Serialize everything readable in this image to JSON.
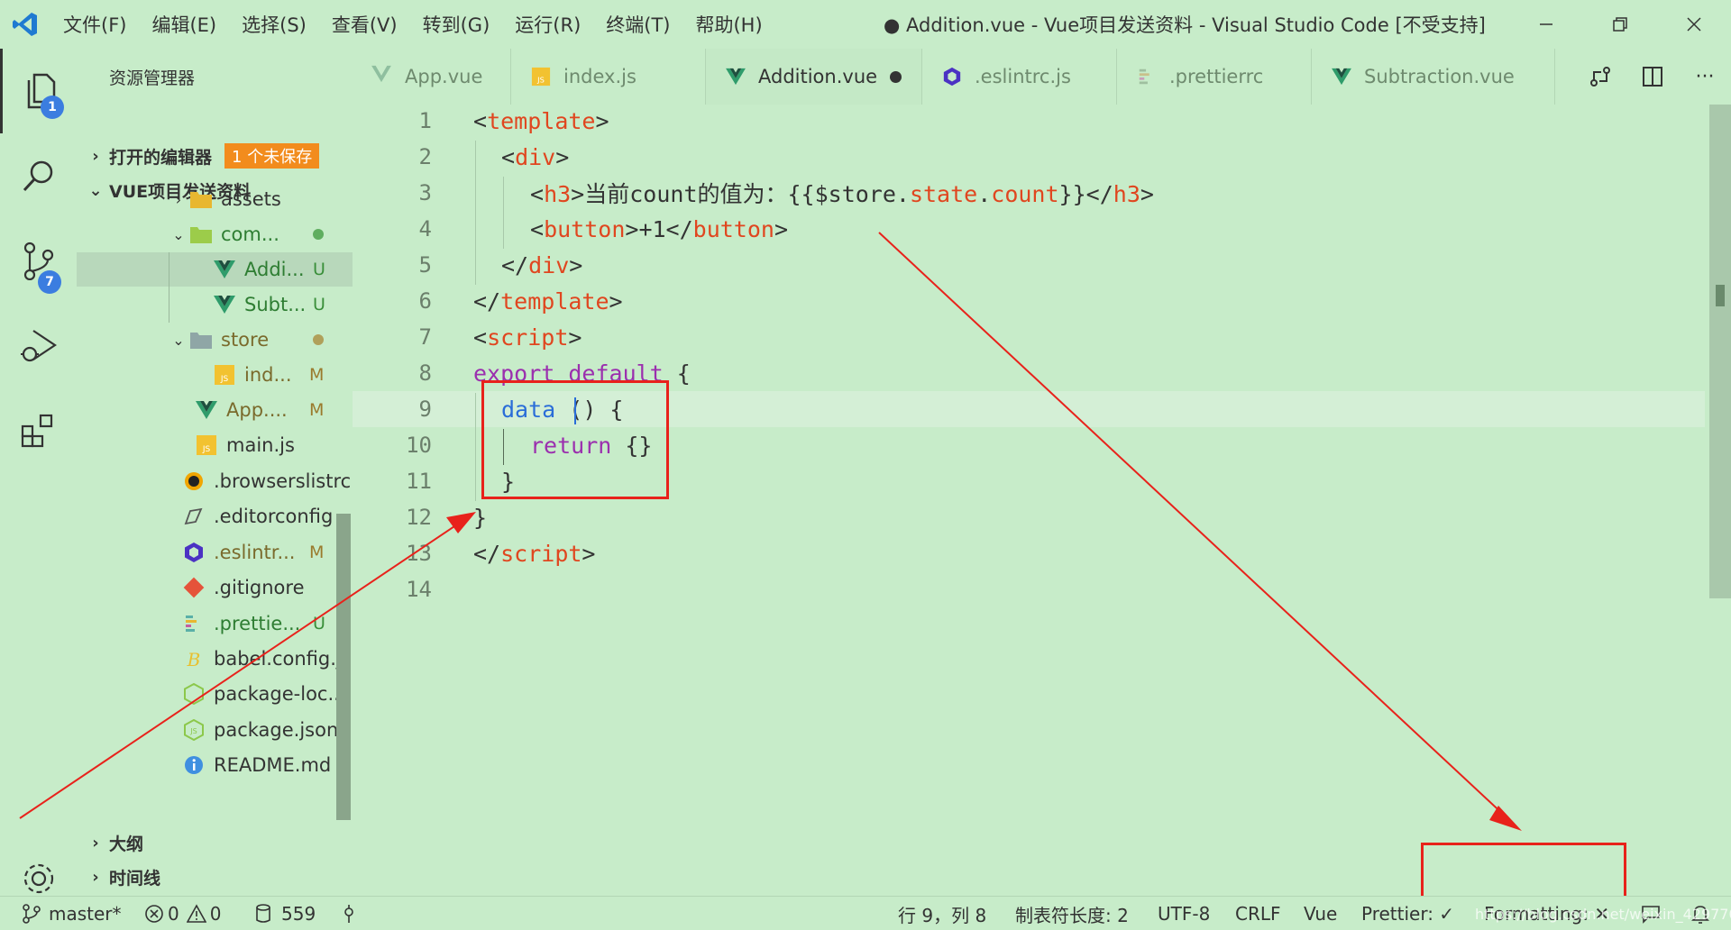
{
  "titlebar": {
    "menu": [
      "文件(F)",
      "编辑(E)",
      "选择(S)",
      "查看(V)",
      "转到(G)",
      "运行(R)",
      "终端(T)",
      "帮助(H)"
    ],
    "title": "● Addition.vue - Vue项目发送资料 - Visual Studio Code [不受支持]"
  },
  "activity": {
    "explorer_badge": "1",
    "scm_badge": "7"
  },
  "sidebar": {
    "header": "资源管理器",
    "open_editors": "打开的编辑器",
    "unsaved_badge": "1 个未保存",
    "project": "VUE项目发送资料",
    "tree": [
      {
        "name": "assets",
        "status": ""
      },
      {
        "name": "com...",
        "status": "dot"
      },
      {
        "name": "Addi...",
        "status": "U"
      },
      {
        "name": "Subt...",
        "status": "U"
      },
      {
        "name": "store",
        "status": "dot"
      },
      {
        "name": "ind...",
        "status": "M"
      },
      {
        "name": "App....",
        "status": "M"
      },
      {
        "name": "main.js",
        "status": ""
      },
      {
        "name": ".browserslistrc",
        "status": ""
      },
      {
        "name": ".editorconfig",
        "status": ""
      },
      {
        "name": ".eslintr...",
        "status": "M"
      },
      {
        "name": ".gitignore",
        "status": ""
      },
      {
        "name": ".prettie...",
        "status": "U"
      },
      {
        "name": "babel.config.js",
        "status": ""
      },
      {
        "name": "package-loc...",
        "status": ""
      },
      {
        "name": "package.json",
        "status": ""
      },
      {
        "name": "README.md",
        "status": ""
      }
    ],
    "outline": "大纲",
    "timeline": "时间线"
  },
  "tabs": [
    {
      "label": "App.vue"
    },
    {
      "label": "index.js"
    },
    {
      "label": "Addition.vue"
    },
    {
      "label": ".eslintrc.js"
    },
    {
      "label": ".prettierrc"
    },
    {
      "label": "Subtraction.vue"
    }
  ],
  "editor": {
    "line_numbers": [
      "1",
      "2",
      "3",
      "4",
      "5",
      "6",
      "7",
      "8",
      "9",
      "10",
      "11",
      "12",
      "13",
      "14"
    ],
    "lines": {
      "l1": [
        "<",
        "template",
        ">"
      ],
      "l2": [
        "<",
        "div",
        ">"
      ],
      "l3": [
        "<",
        "h3",
        ">",
        "当前count的值为：{{$store.",
        "state",
        ".",
        "count",
        "}}</",
        "h3",
        ">"
      ],
      "l4": [
        "<",
        "button",
        ">",
        "+1</",
        "button",
        ">"
      ],
      "l5": [
        "</",
        "div",
        ">"
      ],
      "l6": [
        "</",
        "template",
        ">"
      ],
      "l7": [
        "<",
        "script",
        ">"
      ],
      "l8": [
        "export",
        " ",
        "default",
        " {"
      ],
      "l9": [
        "data",
        " () {"
      ],
      "l10": [
        "return",
        " {}"
      ],
      "l11": [
        "}"
      ],
      "l12": [
        "}"
      ],
      "l13": [
        "</",
        "script",
        ">"
      ]
    }
  },
  "statusbar": {
    "branch": "master*",
    "errors": "0",
    "warnings": "0",
    "db": "559",
    "position": "行 9，列 8",
    "tab_size": "制表符长度: 2",
    "encoding": "UTF-8",
    "eol": "CRLF",
    "language": "Vue",
    "prettier": "Prettier: ✓",
    "formatting": "Formatting: ✕",
    "watermark": "https://blog.csdn.net/weixin_42977042"
  },
  "colors": {
    "background": "#c7ecc9",
    "annotation": "#e8221b",
    "tag": "#e0461f",
    "keyword": "#9b2fae",
    "function": "#2a6dd8"
  }
}
